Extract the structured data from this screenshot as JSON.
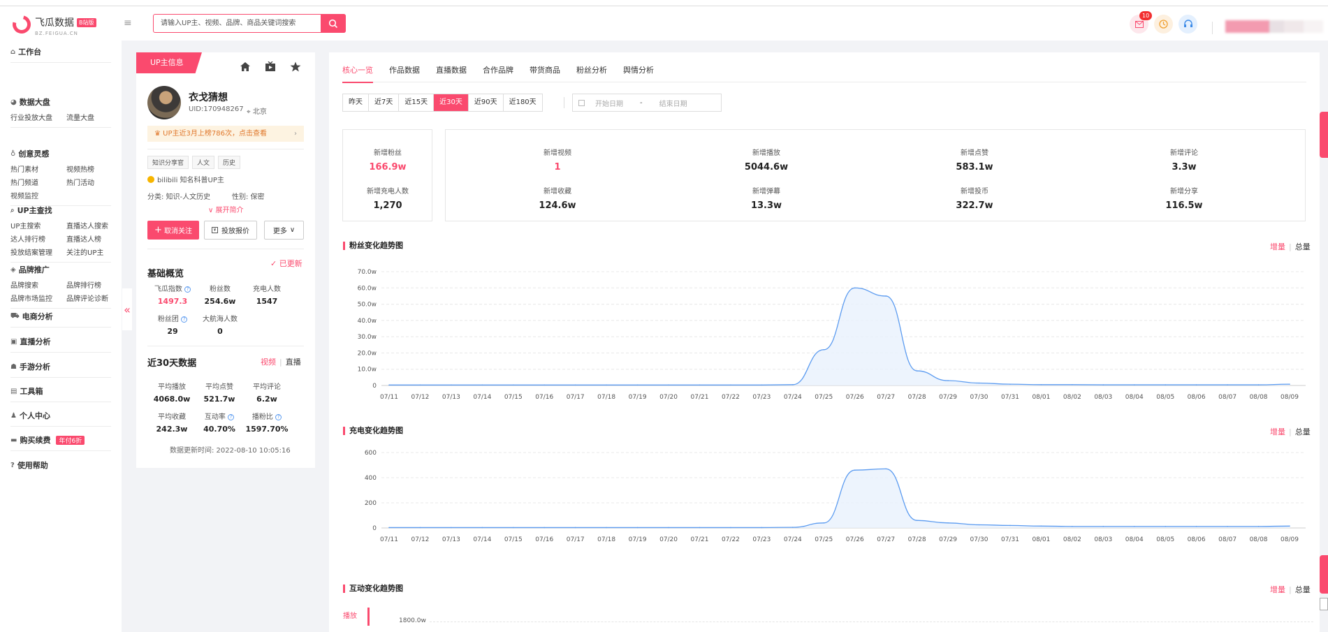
{
  "brand": {
    "name": "飞瓜数据",
    "badge": "B站版",
    "domain": "BZ.FEIGUA.CN"
  },
  "search": {
    "placeholder": "请输入UP主、视频、品牌、商品关键词搜索"
  },
  "header": {
    "notify_count": "10"
  },
  "sidebar": [
    {
      "title": "工作台",
      "icon": "home-icon",
      "items": []
    },
    {
      "title": "数据大盘",
      "icon": "pie-icon",
      "items": [
        "行业投放大盘",
        "流量大盘"
      ]
    },
    {
      "title": "创意灵感",
      "icon": "bulb-icon",
      "items": [
        "热门素材",
        "视频热榜",
        "热门频道",
        "热门活动",
        "视频监控"
      ]
    },
    {
      "title": "UP主查找",
      "icon": "search-icon",
      "items": [
        "UP主搜索",
        "直播达人搜索",
        "达人排行榜",
        "直播达人榜",
        "投放结案管理",
        "关注的UP主"
      ]
    },
    {
      "title": "品牌推广",
      "icon": "diamond-icon",
      "items": [
        "品牌搜索",
        "品牌排行榜",
        "品牌市场监控",
        "品牌评论诊断"
      ]
    },
    {
      "title": "电商分析",
      "icon": "cart-icon",
      "items": []
    },
    {
      "title": "直播分析",
      "icon": "tv-icon",
      "items": []
    },
    {
      "title": "手游分析",
      "icon": "gamepad-icon",
      "items": []
    },
    {
      "title": "工具箱",
      "icon": "toolbox-icon",
      "items": []
    },
    {
      "title": "个人中心",
      "icon": "user-icon",
      "items": []
    },
    {
      "title": "购买续费",
      "icon": "card-icon",
      "items": [],
      "tag": "年付6折"
    },
    {
      "title": "使用帮助",
      "icon": "help-icon",
      "items": []
    }
  ],
  "up": {
    "tab": "UP主信息",
    "name": "衣戈猜想",
    "uid": "UID:170948267",
    "location": "北京",
    "rank_text": "UP主近3月上榜786次，点击查看",
    "tags": [
      "知识分享官",
      "人文",
      "历史"
    ],
    "cert": "bilibili 知名科普UP主",
    "category": "分类: 知识-人文历史",
    "gender": "性别: 保密",
    "expand": "展开简介",
    "btn_unfollow": "取消关注",
    "btn_ad": "投放报价",
    "btn_more": "更多"
  },
  "overview": {
    "title": "基础概览",
    "updated": "已更新",
    "stats": [
      {
        "label": "飞瓜指数",
        "value": "1497.3",
        "help": true,
        "pink": true
      },
      {
        "label": "粉丝数",
        "value": "254.6w"
      },
      {
        "label": "充电人数",
        "value": "1547"
      },
      {
        "label": "粉丝团",
        "value": "29",
        "help": true
      },
      {
        "label": "大航海人数",
        "value": "0"
      }
    ]
  },
  "recent": {
    "title": "近30天数据",
    "switch_video": "视频",
    "switch_live": "直播",
    "stats": [
      {
        "label": "平均播放",
        "value": "4068.0w"
      },
      {
        "label": "平均点赞",
        "value": "521.7w"
      },
      {
        "label": "平均评论",
        "value": "6.2w"
      },
      {
        "label": "平均收藏",
        "value": "242.3w"
      },
      {
        "label": "互动率",
        "value": "40.70%",
        "help": true
      },
      {
        "label": "播粉比",
        "value": "1597.70%",
        "help": true
      }
    ],
    "update_time": "数据更新时间:  2022-08-10 10:05:16"
  },
  "tabs": [
    "核心一览",
    "作品数据",
    "直播数据",
    "合作品牌",
    "带货商品",
    "粉丝分析",
    "舆情分析"
  ],
  "ranges": [
    "昨天",
    "近7天",
    "近15天",
    "近30天",
    "近90天",
    "近180天"
  ],
  "date": {
    "start": "开始日期",
    "end": "结束日期",
    "sep": "-"
  },
  "kpis": [
    {
      "label": "新增粉丝",
      "value": "166.9w",
      "pink": true
    },
    {
      "label": "新增充电人数",
      "value": "1,270"
    },
    {
      "label": "新增视频",
      "value": "1",
      "pink": true
    },
    {
      "label": "新增播放",
      "value": "5044.6w"
    },
    {
      "label": "新增点赞",
      "value": "583.1w"
    },
    {
      "label": "新增评论",
      "value": "3.3w"
    },
    {
      "label": "新增收藏",
      "value": "124.6w"
    },
    {
      "label": "新增弹幕",
      "value": "13.3w"
    },
    {
      "label": "新增投币",
      "value": "322.7w"
    },
    {
      "label": "新增分享",
      "value": "116.5w"
    }
  ],
  "charts": {
    "switch_increase": "增量",
    "switch_total": "总量",
    "interaction": {
      "title": "互动变化趋势图",
      "tab": "播放",
      "top_ylabel": "1800.0w"
    }
  },
  "colors": {
    "accent": "#fa4a6e",
    "line": "#5b9bf0",
    "fill": "#e9f1fd"
  },
  "chart_data": [
    {
      "type": "area",
      "title": "粉丝变化趋势图",
      "x": [
        "07/11",
        "07/12",
        "07/13",
        "07/14",
        "07/15",
        "07/16",
        "07/17",
        "07/18",
        "07/19",
        "07/20",
        "07/21",
        "07/22",
        "07/23",
        "07/24",
        "07/25",
        "07/26",
        "07/27",
        "07/28",
        "07/29",
        "07/30",
        "07/31",
        "08/01",
        "08/02",
        "08/03",
        "08/04",
        "08/05",
        "08/06",
        "08/07",
        "08/08",
        "08/09"
      ],
      "yticks": [
        "0",
        "10.0w",
        "20.0w",
        "30.0w",
        "40.0w",
        "50.0w",
        "60.0w",
        "70.0w"
      ],
      "ylim": [
        0,
        70
      ],
      "series": [
        {
          "values": [
            0.3,
            0.3,
            0.3,
            0.3,
            0.3,
            0.3,
            0.3,
            0.3,
            0.3,
            0.3,
            0.3,
            0.3,
            0.3,
            0.5,
            22,
            60,
            55,
            9,
            3,
            1.5,
            0.8,
            0.5,
            0.5,
            0.4,
            0.4,
            0.4,
            0.4,
            0.4,
            0.4,
            0.8
          ]
        }
      ]
    },
    {
      "type": "area",
      "title": "充电变化趋势图",
      "x": [
        "07/11",
        "07/12",
        "07/13",
        "07/14",
        "07/15",
        "07/16",
        "07/17",
        "07/18",
        "07/19",
        "07/20",
        "07/21",
        "07/22",
        "07/23",
        "07/24",
        "07/25",
        "07/26",
        "07/27",
        "07/28",
        "07/29",
        "07/30",
        "07/31",
        "08/01",
        "08/02",
        "08/03",
        "08/04",
        "08/05",
        "08/06",
        "08/07",
        "08/08",
        "08/09"
      ],
      "yticks": [
        "0",
        "200",
        "400",
        "600"
      ],
      "ylim": [
        0,
        600
      ],
      "series": [
        {
          "values": [
            3,
            3,
            3,
            3,
            3,
            3,
            3,
            3,
            3,
            3,
            3,
            3,
            3,
            5,
            40,
            460,
            470,
            60,
            40,
            25,
            20,
            15,
            12,
            12,
            12,
            12,
            12,
            12,
            12,
            15
          ]
        }
      ]
    }
  ]
}
